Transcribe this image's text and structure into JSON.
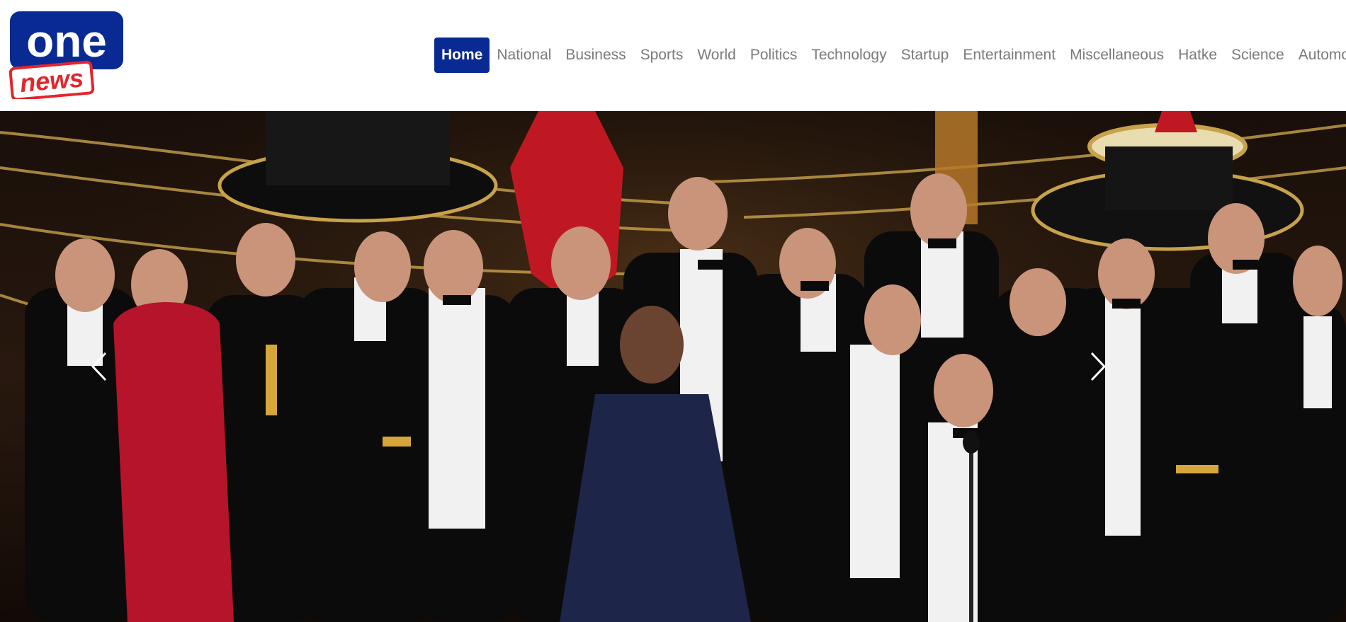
{
  "brand": {
    "logo_word_top": "one",
    "logo_word_bottom": "news",
    "colors": {
      "primary": "#0a2a93",
      "accent": "#e3252c"
    }
  },
  "nav": {
    "items": [
      {
        "label": "Home",
        "active": true
      },
      {
        "label": "National"
      },
      {
        "label": "Business"
      },
      {
        "label": "Sports"
      },
      {
        "label": "World"
      },
      {
        "label": "Politics"
      },
      {
        "label": "Technology"
      },
      {
        "label": "Startup"
      },
      {
        "label": "Entertainment"
      },
      {
        "label": "Miscellaneous"
      },
      {
        "label": "Hatke"
      },
      {
        "label": "Science"
      },
      {
        "label": "Automobile"
      }
    ]
  },
  "carousel": {
    "prev_icon": "chevron-left-icon",
    "next_icon": "chevron-right-icon",
    "slide_description_icon": "award-ceremony-photo"
  }
}
